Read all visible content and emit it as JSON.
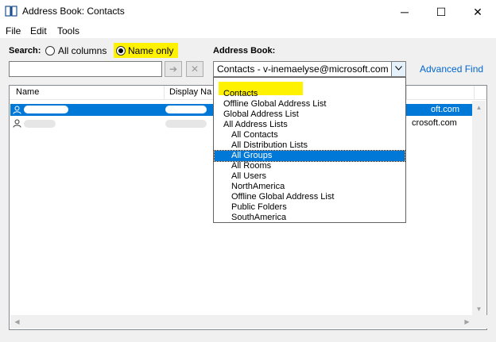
{
  "window": {
    "title": "Address Book: Contacts",
    "minimize_glyph": "─",
    "maximize_glyph": "☐",
    "close_glyph": "✕"
  },
  "menu": [
    "File",
    "Edit",
    "Tools"
  ],
  "search": {
    "label": "Search:",
    "option_all": "All columns",
    "option_name": "Name only",
    "selected": "Name only",
    "value": "",
    "go_glyph": "➔",
    "clear_glyph": "✕"
  },
  "address_book": {
    "label": "Address Book:",
    "value": "Contacts - v-inemaelyse@microsoft.com",
    "advanced_find": "Advanced Find",
    "options": [
      {
        "label": "Contacts",
        "indent": 1
      },
      {
        "label": "Offline Global Address List",
        "indent": 1
      },
      {
        "label": "Global Address List",
        "indent": 1
      },
      {
        "label": "All Address Lists",
        "indent": 1
      },
      {
        "label": "All Contacts",
        "indent": 2
      },
      {
        "label": "All Distribution Lists",
        "indent": 2
      },
      {
        "label": "All Groups",
        "indent": 2
      },
      {
        "label": "All Rooms",
        "indent": 2
      },
      {
        "label": "All Users",
        "indent": 2
      },
      {
        "label": "NorthAmerica",
        "indent": 2
      },
      {
        "label": "Offline Global Address List",
        "indent": 2
      },
      {
        "label": "Public Folders",
        "indent": 2
      },
      {
        "label": "SouthAmerica",
        "indent": 2
      }
    ],
    "highlighted_option": "All Groups"
  },
  "list": {
    "columns": [
      "Name",
      "Display Na"
    ],
    "rows": [
      {
        "email_fragment": "oft.com",
        "selected": true
      },
      {
        "email_fragment": "crosoft.com",
        "selected": false
      }
    ]
  },
  "colors": {
    "highlight_yellow": "#fff200",
    "selection_blue": "#0078d7",
    "link_blue": "#0066cc"
  },
  "icons": [
    "address-book-icon",
    "person-icon",
    "arrow-right-icon",
    "close-icon",
    "chevron-down-icon"
  ]
}
